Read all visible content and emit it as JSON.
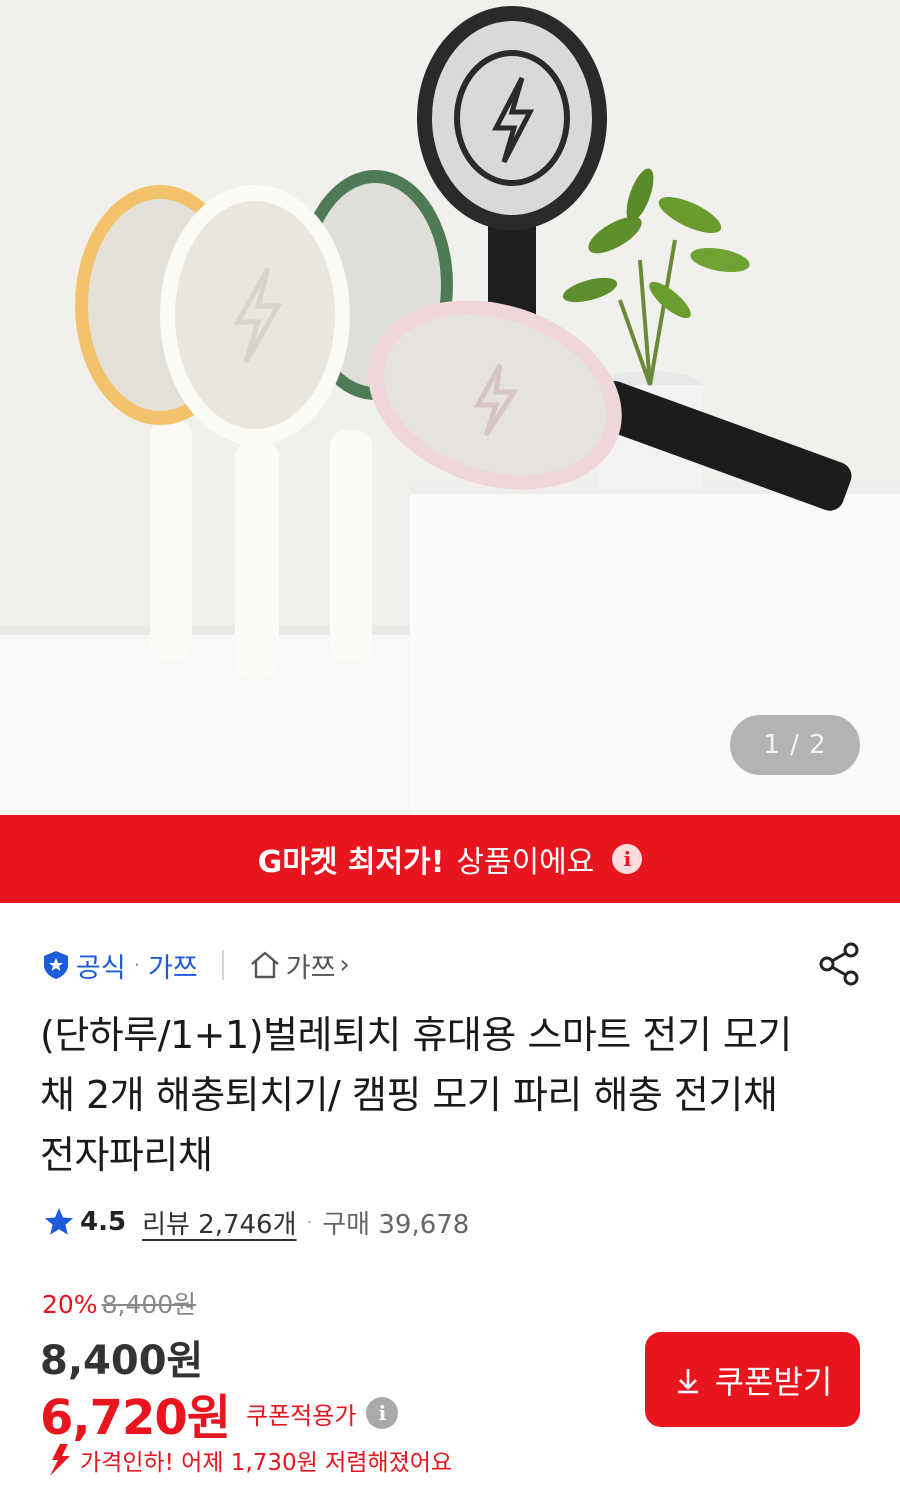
{
  "gallery": {
    "page_indicator": "1 / 2"
  },
  "banner": {
    "strong_text": "G마켓 최저가!",
    "text": "상품이에요",
    "info_icon": "info-icon"
  },
  "seller": {
    "official_label": "공식",
    "brand_name": "가쯔",
    "store_name": "가쯔",
    "store_chevron": "›"
  },
  "product": {
    "title": "(단하루/1+1)벌레퇴치 휴대용 스마트 전기 모기채 2개 해충퇴치기/ 캠핑 모기 파리 해충 전기채 전자파리채"
  },
  "rating": {
    "score": "4.5",
    "review_label": "리뷰 2,746개",
    "purchase_label": "구매 39,678"
  },
  "price": {
    "discount_rate": "20%",
    "original_price": "8,400원",
    "price": "8,400원",
    "coupon_price": "6,720원",
    "coupon_label": "쿠폰적용가",
    "price_drop_text": "가격인하! 어제 1,730원 저렴해졌어요"
  },
  "actions": {
    "coupon_button_label": "쿠폰받기"
  },
  "colors": {
    "brand_red": "#e8141e",
    "link_blue": "#1d5bd8"
  }
}
